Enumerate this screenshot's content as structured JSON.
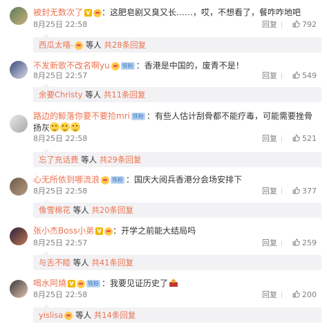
{
  "comments": [
    {
      "username": "被封无数次了",
      "text": "这肥皂剧又臭又长……，哎，不想看了，餐咋咋地吧",
      "time": "8月25日 22:58",
      "reply_label": "回复",
      "likes": "792",
      "sub": {
        "name": "西瓜太嘻-",
        "etc": "等人",
        "count": "共28条回复"
      }
    },
    {
      "username": "不发新歌不改名啊yu",
      "text": "香港是中国的，废青不是！",
      "time": "8月25日 22:57",
      "reply_label": "回复",
      "likes": "549",
      "sub": {
        "name": "余要Christy",
        "etc": "等人",
        "count": "共11条回复"
      }
    },
    {
      "username": "路边的鲸落你要不要捡mri",
      "text": "有些人估计刮骨都不能疗毒，可能需要挫骨扬灰",
      "time": "8月25日 22:58",
      "reply_label": "回复",
      "likes": "521",
      "sub": {
        "name": "忘了充话费",
        "etc": "等人",
        "count": "共29条回复"
      }
    },
    {
      "username": "心无所依到哪流浪",
      "text": "国庆大阅兵香港分会场安排下",
      "time": "8月25日 22:58",
      "reply_label": "回复",
      "likes": "377",
      "sub": {
        "name": "像雪棉花",
        "etc": "等人",
        "count": "共20条回复"
      }
    },
    {
      "username": "张小杰Boss小弟",
      "text": "开学之前能大结局吗",
      "time": "8月25日 22:57",
      "reply_label": "回复",
      "likes": "259",
      "sub": {
        "name": "与舌不睦",
        "etc": "等人",
        "count": "共41条回复"
      }
    },
    {
      "username": "喝水阿燒",
      "text": "我要见证历史了",
      "time": "8月25日 22:58",
      "reply_label": "回复",
      "likes": "200",
      "sub": {
        "name": "yislisa",
        "etc": "等人",
        "count": "共14条回复"
      }
    }
  ],
  "badges": {
    "pro": "铁粉"
  },
  "colors": {
    "link": "#eb7350",
    "muted": "#808080",
    "subbar_bg": "#f2f2f5"
  }
}
